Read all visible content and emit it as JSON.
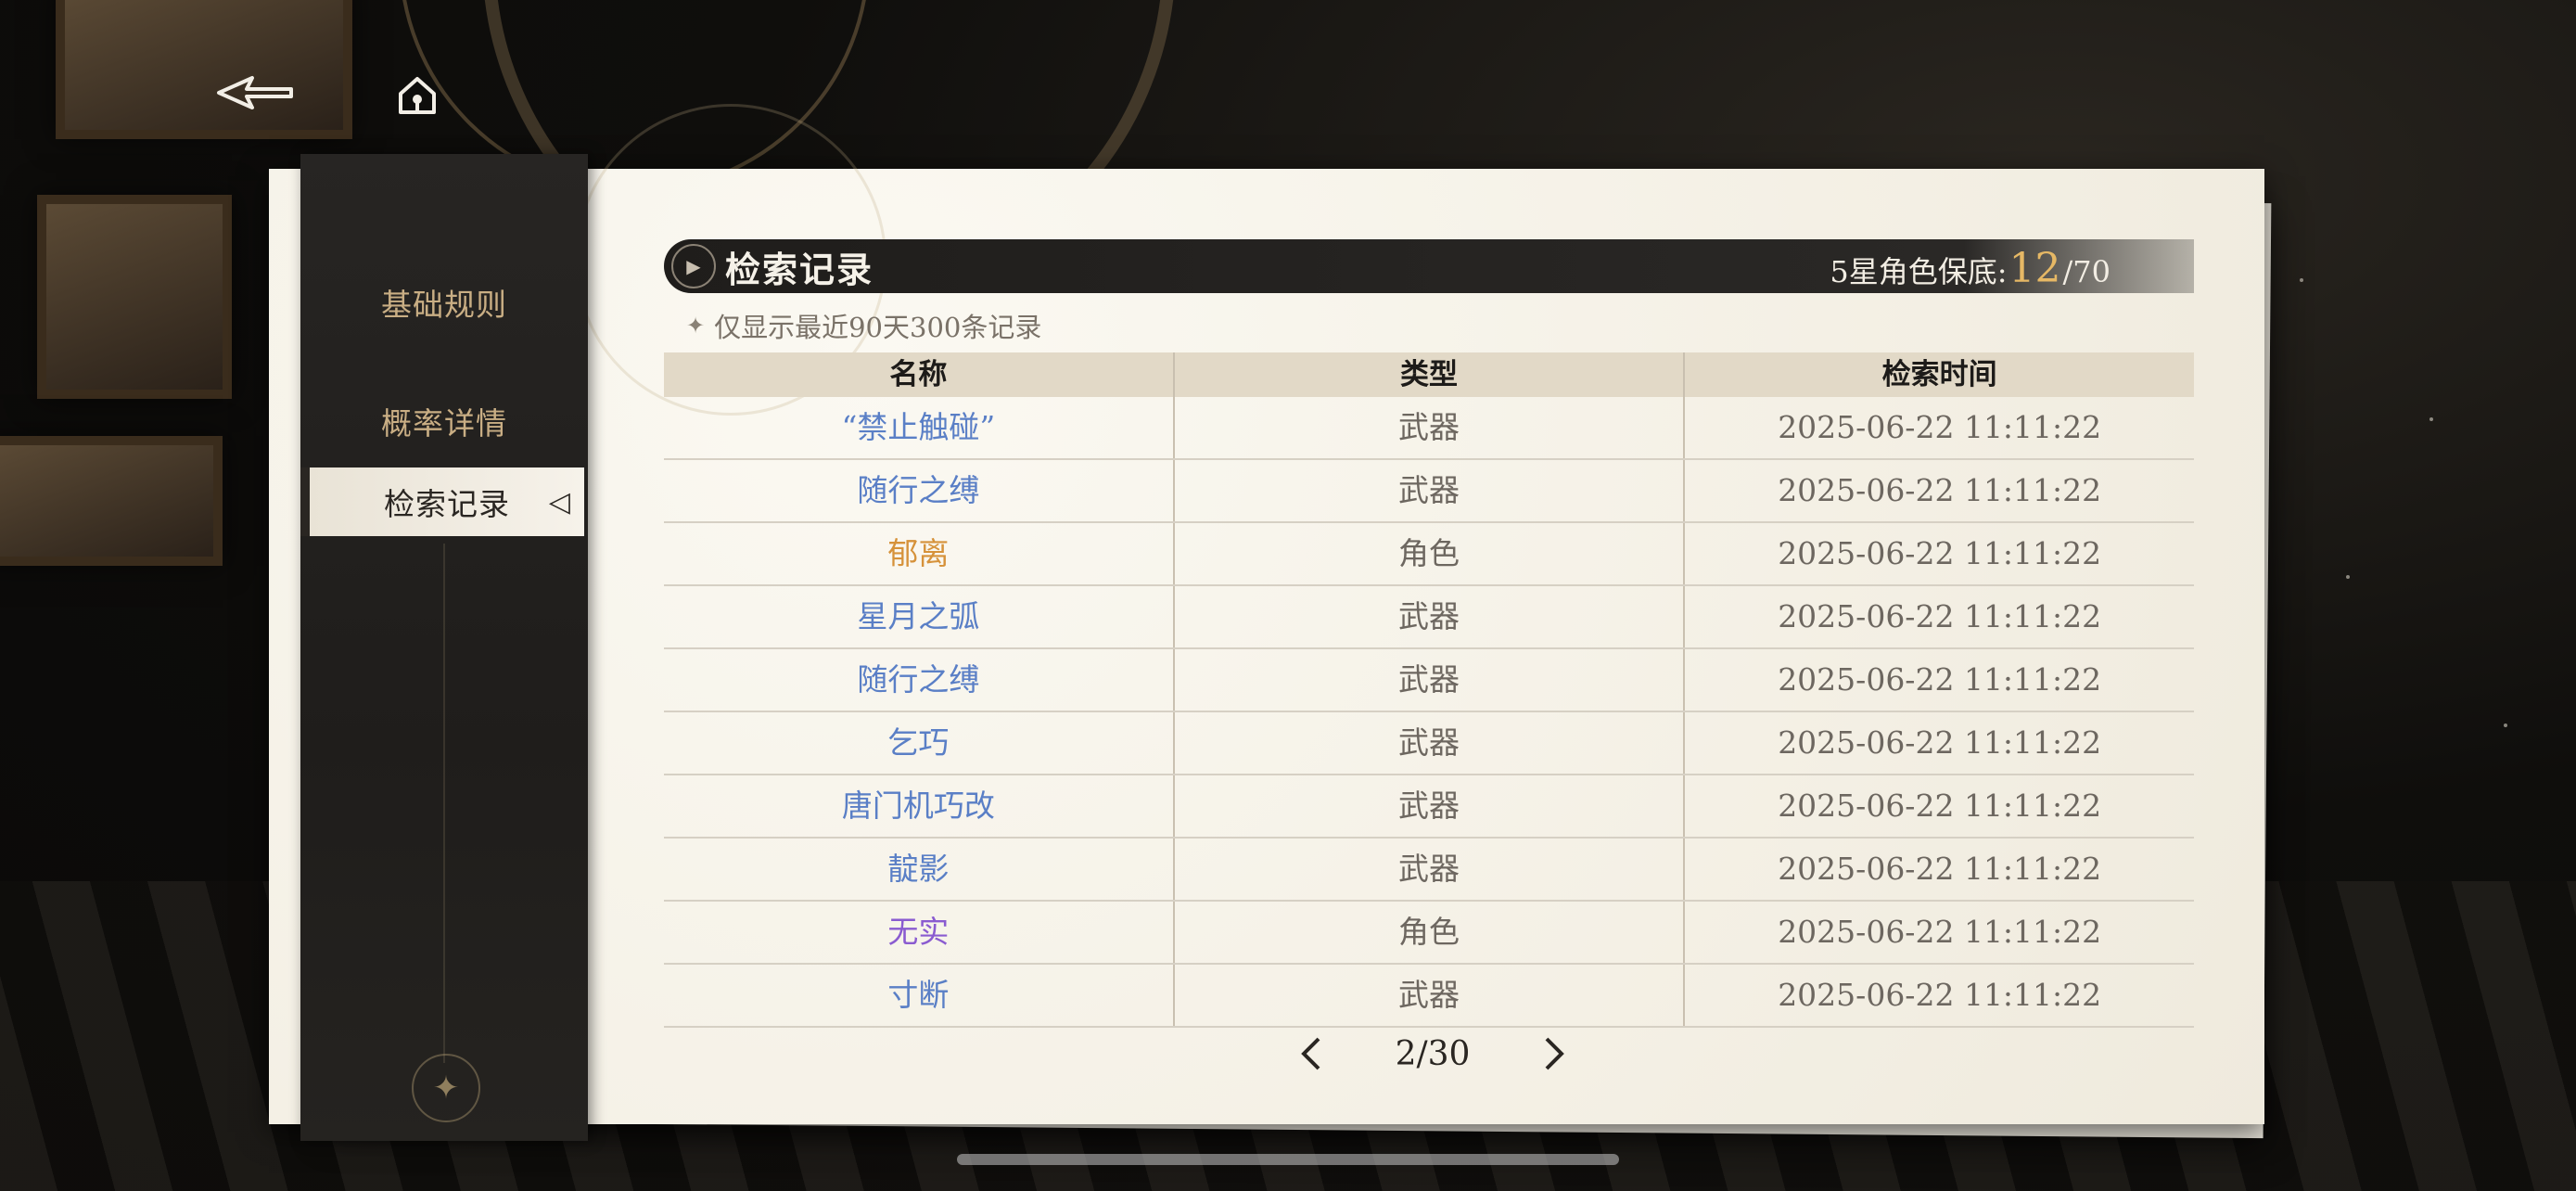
{
  "nav": {
    "back_icon": "back-arrow-icon",
    "home_icon": "home-icon"
  },
  "sidebar": {
    "items": [
      {
        "label": "基础规则",
        "active": false
      },
      {
        "label": "概率详情",
        "active": false
      },
      {
        "label": "检索记录",
        "active": true
      }
    ]
  },
  "header": {
    "title": "检索记录",
    "pity_label": "5星角色保底:",
    "pity_current": "12",
    "pity_max": "/70"
  },
  "note": "仅显示最近90天300条记录",
  "table": {
    "columns": [
      "名称",
      "类型",
      "检索时间"
    ],
    "rows": [
      {
        "name": "“禁止触碰”",
        "type": "武器",
        "time": "2025-06-22 11:11:22",
        "rarity_color": "#5a7fc6"
      },
      {
        "name": "随行之缚",
        "type": "武器",
        "time": "2025-06-22 11:11:22",
        "rarity_color": "#5a7fc6"
      },
      {
        "name": "郁离",
        "type": "角色",
        "time": "2025-06-22 11:11:22",
        "rarity_color": "#d6923a"
      },
      {
        "name": "星月之弧",
        "type": "武器",
        "time": "2025-06-22 11:11:22",
        "rarity_color": "#5a7fc6"
      },
      {
        "name": "随行之缚",
        "type": "武器",
        "time": "2025-06-22 11:11:22",
        "rarity_color": "#5a7fc6"
      },
      {
        "name": "乞巧",
        "type": "武器",
        "time": "2025-06-22 11:11:22",
        "rarity_color": "#5a7fc6"
      },
      {
        "name": "唐门机巧改",
        "type": "武器",
        "time": "2025-06-22 11:11:22",
        "rarity_color": "#5a7fc6"
      },
      {
        "name": "靛影",
        "type": "武器",
        "time": "2025-06-22 11:11:22",
        "rarity_color": "#5a7fc6"
      },
      {
        "name": "无实",
        "type": "角色",
        "time": "2025-06-22 11:11:22",
        "rarity_color": "#8a5bd0"
      },
      {
        "name": "寸断",
        "type": "武器",
        "time": "2025-06-22 11:11:22",
        "rarity_color": "#5a7fc6"
      }
    ]
  },
  "pager": {
    "text": "2/30"
  }
}
